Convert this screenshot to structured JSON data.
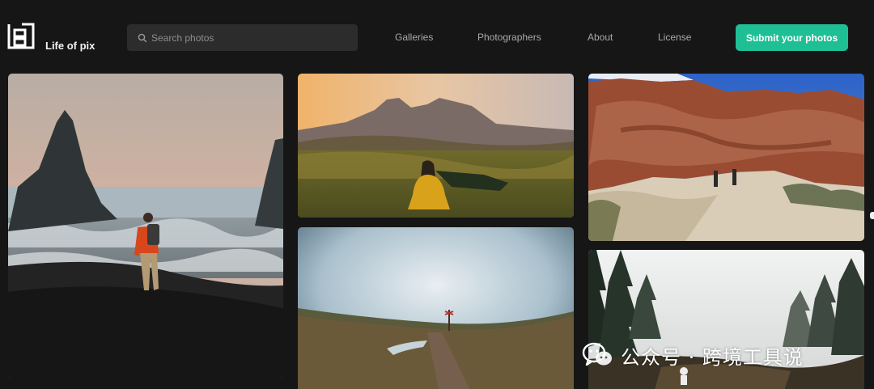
{
  "header": {
    "brand": "Life of pix",
    "search": {
      "placeholder": "Search photos",
      "value": ""
    },
    "nav": [
      {
        "label": "Galleries"
      },
      {
        "label": "Photographers"
      },
      {
        "label": "About"
      },
      {
        "label": "License"
      }
    ],
    "submit_label": "Submit your photos"
  },
  "gallery": {
    "photos": [
      {
        "subject": "hiker in orange jacket facing sea stacks on a black sand beach"
      },
      {
        "subject": "woman in yellow jacket sitting in an alpine meadow at sunset"
      },
      {
        "subject": "two hikers walking a sandy trail beneath red rock cliffs"
      },
      {
        "subject": "muddy dirt path through a foggy moorland"
      },
      {
        "subject": "misty pine forest with a small figure"
      }
    ]
  },
  "overlay": {
    "watermark_text": "公众号 · 跨境工具说"
  },
  "colors": {
    "background": "#161616",
    "search_bg": "#2c2c2c",
    "nav_text": "#a9a9a9",
    "accent": "#1fbf95"
  }
}
